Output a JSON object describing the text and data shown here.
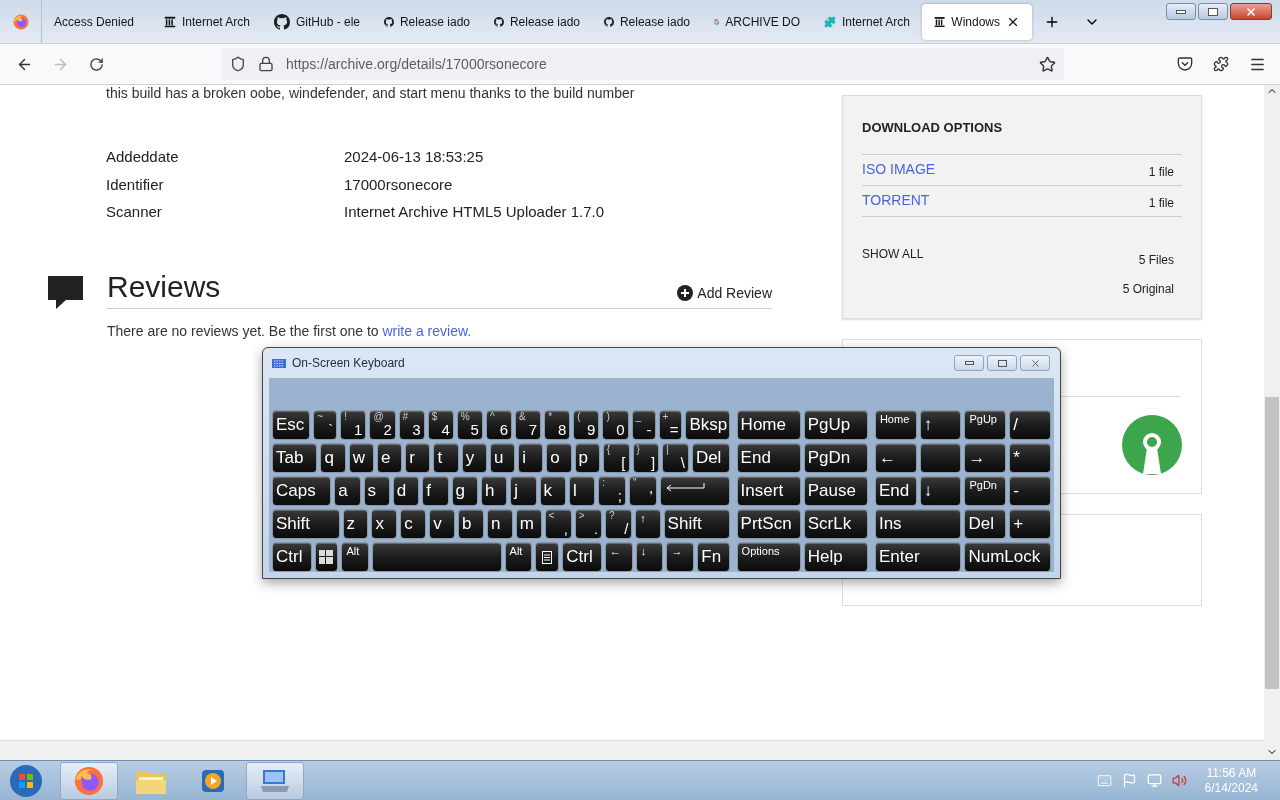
{
  "browser": {
    "tabs": [
      {
        "label": "Access Denied",
        "kind": "plain",
        "selected": false
      },
      {
        "label": "Internet Arch",
        "kind": "archive",
        "selected": false
      },
      {
        "label": "GitHub - ele",
        "kind": "github",
        "selected": false
      },
      {
        "label": "Release iado",
        "kind": "github",
        "selected": false
      },
      {
        "label": "Release iado",
        "kind": "github",
        "selected": false
      },
      {
        "label": "Release iado",
        "kind": "github",
        "selected": false
      },
      {
        "label": "ARCHIVE DO",
        "kind": "google",
        "selected": false
      },
      {
        "label": "Internet Arch",
        "kind": "puzzle",
        "selected": false
      },
      {
        "label": "Windows",
        "kind": "archive",
        "selected": true
      }
    ],
    "url": "https://archive.org/details/17000rsonecore"
  },
  "page": {
    "description": "this build has a broken oobe, windefender, and start menu thanks to the build number",
    "metadata": [
      {
        "label": "Addeddate",
        "value": "2024-06-13 18:53:25"
      },
      {
        "label": "Identifier",
        "value": "17000rsonecore"
      },
      {
        "label": "Scanner",
        "value": "Internet Archive HTML5 Uploader 1.7.0"
      }
    ],
    "reviews": {
      "title": "Reviews",
      "add_label": "Add Review",
      "empty_text": "There are no reviews yet. Be the first one to",
      "link": "write a review."
    },
    "download": {
      "title": "DOWNLOAD OPTIONS",
      "options": [
        {
          "label": "ISO IMAGE",
          "count": "1 file"
        },
        {
          "label": "TORRENT",
          "count": "1 file"
        }
      ],
      "show_all": "SHOW ALL",
      "files": "5 Files",
      "original": "5 Original"
    }
  },
  "keyboard": {
    "title": "On-Screen Keyboard",
    "main_rows": [
      [
        {
          "kind": "text",
          "label": "Esc"
        },
        {
          "kind": "dual",
          "label": "`",
          "shift": "~"
        },
        {
          "kind": "dual",
          "label": "1",
          "shift": "!"
        },
        {
          "kind": "dual",
          "label": "2",
          "shift": "@"
        },
        {
          "kind": "dual",
          "label": "3",
          "shift": "#"
        },
        {
          "kind": "dual",
          "label": "4",
          "shift": "$"
        },
        {
          "kind": "dual",
          "label": "5",
          "shift": "%"
        },
        {
          "kind": "dual",
          "label": "6",
          "shift": "^"
        },
        {
          "kind": "dual",
          "label": "7",
          "shift": "&"
        },
        {
          "kind": "dual",
          "label": "8",
          "shift": "*"
        },
        {
          "kind": "dual",
          "label": "9",
          "shift": "("
        },
        {
          "kind": "dual",
          "label": "0",
          "shift": ")"
        },
        {
          "kind": "dual",
          "label": "-",
          "shift": "_"
        },
        {
          "kind": "dual",
          "label": "=",
          "shift": "+"
        },
        {
          "kind": "text",
          "label": "Bksp"
        }
      ],
      [
        {
          "kind": "text",
          "label": "Tab"
        },
        {
          "kind": "text",
          "label": "q"
        },
        {
          "kind": "text",
          "label": "w"
        },
        {
          "kind": "text",
          "label": "e"
        },
        {
          "kind": "text",
          "label": "r"
        },
        {
          "kind": "text",
          "label": "t"
        },
        {
          "kind": "text",
          "label": "y"
        },
        {
          "kind": "text",
          "label": "u"
        },
        {
          "kind": "text",
          "label": "i"
        },
        {
          "kind": "text",
          "label": "o"
        },
        {
          "kind": "text",
          "label": "p"
        },
        {
          "kind": "dual",
          "label": "[",
          "shift": "{"
        },
        {
          "kind": "dual",
          "label": "]",
          "shift": "}"
        },
        {
          "kind": "dual",
          "label": "\\",
          "shift": "|"
        },
        {
          "kind": "text",
          "label": "Del"
        }
      ],
      [
        {
          "kind": "text",
          "label": "Caps"
        },
        {
          "kind": "text",
          "label": "a"
        },
        {
          "kind": "text",
          "label": "s"
        },
        {
          "kind": "text",
          "label": "d"
        },
        {
          "kind": "text",
          "label": "f"
        },
        {
          "kind": "text",
          "label": "g"
        },
        {
          "kind": "text",
          "label": "h"
        },
        {
          "kind": "text",
          "label": "j"
        },
        {
          "kind": "text",
          "label": "k"
        },
        {
          "kind": "text",
          "label": "l"
        },
        {
          "kind": "dual",
          "label": ";",
          "shift": ":"
        },
        {
          "kind": "dual",
          "label": "'",
          "shift": "\""
        },
        {
          "kind": "enter"
        }
      ],
      [
        {
          "kind": "text",
          "label": "Shift"
        },
        {
          "kind": "text",
          "label": "z"
        },
        {
          "kind": "text",
          "label": "x"
        },
        {
          "kind": "text",
          "label": "c"
        },
        {
          "kind": "text",
          "label": "v"
        },
        {
          "kind": "text",
          "label": "b"
        },
        {
          "kind": "text",
          "label": "n"
        },
        {
          "kind": "text",
          "label": "m"
        },
        {
          "kind": "dual",
          "label": ",",
          "shift": "<"
        },
        {
          "kind": "dual",
          "label": ".",
          "shift": ">"
        },
        {
          "kind": "dual",
          "label": "/",
          "shift": "?"
        },
        {
          "kind": "small",
          "label": "↑"
        },
        {
          "kind": "text",
          "label": "Shift"
        }
      ],
      [
        {
          "kind": "text",
          "label": "Ctrl"
        },
        {
          "kind": "windows"
        },
        {
          "kind": "small",
          "label": "Alt"
        },
        {
          "kind": "space"
        },
        {
          "kind": "small",
          "label": "Alt"
        },
        {
          "kind": "menu"
        },
        {
          "kind": "text",
          "label": "Ctrl"
        },
        {
          "kind": "small",
          "label": "←"
        },
        {
          "kind": "small",
          "label": "↓"
        },
        {
          "kind": "small",
          "label": "→"
        },
        {
          "kind": "text",
          "label": "Fn"
        }
      ]
    ],
    "nav_rows": [
      [
        {
          "kind": "text",
          "label": "Home"
        },
        {
          "kind": "text",
          "label": "PgUp"
        }
      ],
      [
        {
          "kind": "text",
          "label": "End"
        },
        {
          "kind": "text",
          "label": "PgDn"
        }
      ],
      [
        {
          "kind": "text",
          "label": "Insert"
        },
        {
          "kind": "text",
          "label": "Pause"
        }
      ],
      [
        {
          "kind": "text",
          "label": "PrtScn"
        },
        {
          "kind": "text",
          "label": "ScrLk"
        }
      ],
      [
        {
          "kind": "small",
          "label": "Options"
        },
        {
          "kind": "text",
          "label": "Help"
        }
      ]
    ],
    "numpad_rows": [
      [
        {
          "kind": "small",
          "label": "Home"
        },
        {
          "kind": "text",
          "label": "↑"
        },
        {
          "kind": "small",
          "label": "PgUp"
        },
        {
          "kind": "text",
          "label": "/"
        }
      ],
      [
        {
          "kind": "text",
          "label": "←"
        },
        {
          "kind": "blank"
        },
        {
          "kind": "text",
          "label": "→"
        },
        {
          "kind": "text",
          "label": "*"
        }
      ],
      [
        {
          "kind": "text",
          "label": "End"
        },
        {
          "kind": "text",
          "label": "↓"
        },
        {
          "kind": "small",
          "label": "PgDn"
        },
        {
          "kind": "text",
          "label": "-"
        }
      ],
      [
        {
          "kind": "text",
          "label": "Ins"
        },
        {
          "kind": "text",
          "label": "Del"
        },
        {
          "kind": "text",
          "label": "+"
        }
      ],
      [
        {
          "kind": "text",
          "label": "Enter"
        },
        {
          "kind": "text",
          "label": "NumLock"
        }
      ]
    ]
  },
  "taskbar": {
    "apps": [
      {
        "kind": "firefox",
        "active": true
      },
      {
        "kind": "explorer",
        "active": false
      },
      {
        "kind": "media",
        "active": false
      },
      {
        "kind": "keyboard",
        "active": true
      }
    ],
    "time": "11:56 AM",
    "date": "6/14/2024"
  }
}
